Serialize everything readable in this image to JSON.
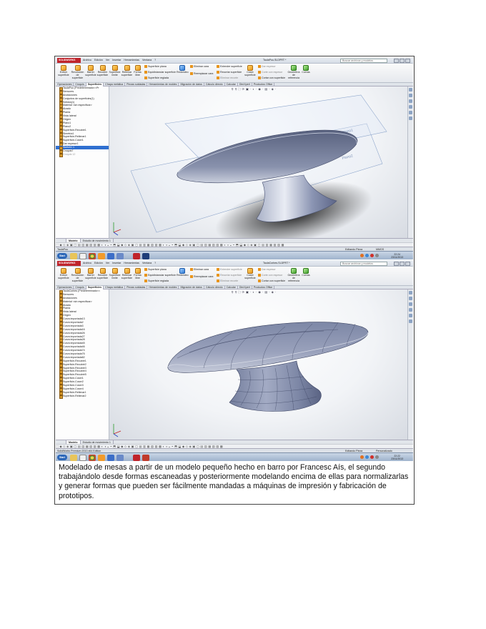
{
  "screenshot_top": {
    "app_logo": "SOLIDWORKS",
    "menus": [
      "Archivo",
      "Edición",
      "Ver",
      "Insertar",
      "Herramientas",
      "Ventana",
      "?"
    ],
    "document_title": "TaulaPou.SLDPRT *",
    "search_placeholder": "Buscar archivos y modelos",
    "ribbon": {
      "extruir": "Extruir superficie",
      "revolucion": "Revolución de superficie",
      "barrer": "Barrer superficie",
      "recubrir": "Recubrir superficie",
      "limite": "Superficie límite",
      "rellenar": "Rellenar superficie",
      "forma_libre": "Forma libre",
      "sup_plana": "Superficie plana",
      "equidistancia": "Equidistanciar superficie",
      "sup_reglada": "Superficie reglada",
      "redondeo": "Redondeo",
      "eliminar_cara": "Eliminar cara",
      "reemplazar_cara": "Reemplazar cara",
      "extender": "Extender superficie",
      "recortar": "Recortar superficie",
      "eliminar_recorte": "Eliminar recorte",
      "coser": "Coser superficie",
      "dar_espesor": "Dar espesor",
      "corte_espesor": "Corte con espesor",
      "cortar_superficie": "Cortar con superficie",
      "geometria": "Geometría de referencia",
      "curvas": "Curvas"
    },
    "tabs": [
      "Operaciones",
      "Croquis",
      "Superficies",
      "Chapa metálica",
      "Piezas soldadas",
      "Herramientas de moldes",
      "Migración de datos",
      "Cálculo directo",
      "Calcular",
      "DimXpert",
      "Productos Office"
    ],
    "active_tab": "Superficies",
    "tree": [
      "TaulaPou (Predeterminado<<Pr",
      "Sensores",
      "Anotaciones",
      "Conjuntos de superficies(1)",
      "Sólidos(1)",
      "Material <sin especificar>",
      "Alzado",
      "Planta",
      "Vista lateral",
      "Origen",
      "Plano1",
      "Plano2",
      "Superficie-Recubrir1",
      "Simetría1",
      "Superficie-Rellenar1",
      "Superficie-Coser1",
      "Dar espesor1",
      "Sketch1 1",
      "Croquis7",
      "Croquis 12"
    ],
    "tree_selected": "Sketch1 1",
    "plane_labels": [
      "Plano1",
      "Plano2"
    ],
    "model_tabs": [
      "Modelo",
      "Estudio de movimiento 1"
    ],
    "status_left": "TaulaPou",
    "status_mode": "Editando Pieza",
    "status_units": "MMGS",
    "clock_time": "22:24",
    "clock_date": "23/11/2013"
  },
  "screenshot_bottom": {
    "app_logo": "SOLIDWORKS",
    "menus": [
      "Archivo",
      "Edición",
      "Ver",
      "Insertar",
      "Herramientas",
      "Ventana",
      "?"
    ],
    "document_title": "TaulaCorbes.SLDPRT *",
    "search_placeholder": "Buscar archivos y modelos",
    "tabs": [
      "Operaciones",
      "Croquis",
      "Superficies",
      "Chapa metálica",
      "Piezas soldadas",
      "Herramientas de moldes",
      "Migración de datos",
      "Cálculo directo",
      "Calcular",
      "DimXpert",
      "Productos Office"
    ],
    "active_tab": "Superficies",
    "tree": [
      "TaulaCorbes (Predeterminado<<",
      "Sensores",
      "Anotaciones",
      "Material <sin especificar>",
      "Alzado",
      "Planta",
      "Vista lateral",
      "Origen",
      "Curva importada13",
      "Curva importada2",
      "Curva importada3",
      "Curva importada16",
      "Curva importada26",
      "Curva importada27",
      "Curva importada28",
      "Curva importada45",
      "Curva importada46",
      "Curva importada74",
      "Curva importada76",
      "Curva importada82",
      "Superficie-Recubrir1",
      "Superficie-Recubrir2",
      "Superficie-Recubrir3",
      "Superficie-Recubrir4",
      "Superficie-Recubrir5",
      "Superficie-Coser1",
      "Superficie-Coser2",
      "Superficie-Coser3",
      "Superficie-Coser4",
      "Superficie-Rellenar1",
      "Superficie-Rellenar2"
    ],
    "model_tabs": [
      "Modelo",
      "Estudio de movimiento 1"
    ],
    "status_left": "SolidWorks Premium 2013 x64 Edition",
    "status_mode": "Editando Pieza",
    "status_units": "Personalizado",
    "clock_time": "22:22",
    "clock_date": "23/11/2013"
  },
  "caption": "Modelado de mesas a partir de un modelo pequeño hecho en barro por Francesc Aís, el segundo trabajándolo desde formas escaneadas y posteriormente modelando encima de ellas para normalizarlas y generar formas que pueden ser fácilmente mandadas a máquinas de impresión y fabricación de prototipos.",
  "colors": {
    "solidworks_red": "#c0242b",
    "selection_blue": "#2f6fd0",
    "model_grey": "#6f7fa0"
  }
}
